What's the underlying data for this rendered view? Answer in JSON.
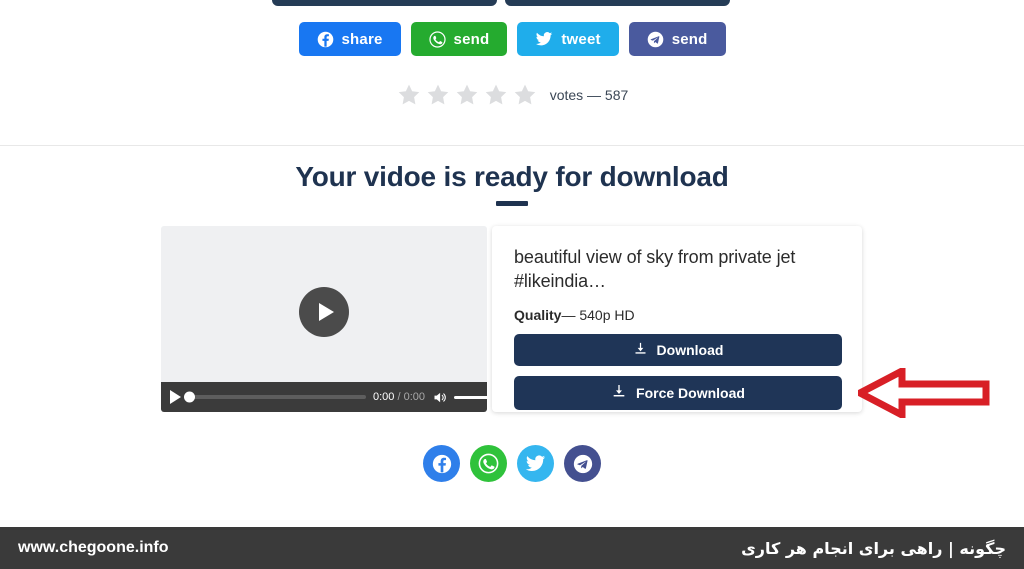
{
  "top_cut_buttons": [
    {
      "name": "cut-button-left"
    },
    {
      "name": "cut-button-right"
    }
  ],
  "share_row": {
    "buttons": [
      {
        "label": "share",
        "network": "facebook",
        "icon": "facebook-icon",
        "color": "#1877f2"
      },
      {
        "label": "send",
        "network": "whatsapp",
        "icon": "whatsapp-icon",
        "color": "#25ab2f"
      },
      {
        "label": "tweet",
        "network": "twitter",
        "icon": "twitter-icon",
        "color": "#1fadeb"
      },
      {
        "label": "send",
        "network": "telegram",
        "icon": "telegram-icon",
        "color": "#4a5a9e"
      }
    ]
  },
  "rating": {
    "stars_total": 5,
    "stars_filled": 0,
    "star_color": "#dcdddf",
    "votes_text": "votes — 587",
    "votes_count": 587
  },
  "heading": {
    "title": "Your vidoe is ready for download",
    "accent_color": "#1f3350"
  },
  "player": {
    "thumbnail_bg": "#eff0f2",
    "big_play_icon": "play-icon",
    "controls": {
      "play_icon": "play-icon",
      "current_time": "0:00",
      "separator": "/",
      "duration": "0:00",
      "volume_icon": "volume-icon",
      "fullscreen_icon": "fullscreen-icon",
      "progress_percent": 0,
      "volume_percent": 100
    }
  },
  "info_card": {
    "video_title": "beautiful view of sky from private jet #likeindia…",
    "quality_label": "Quality",
    "quality_separator": "—",
    "quality_value": "540p HD",
    "buttons": [
      {
        "label": "Download",
        "icon": "download-icon",
        "color": "#1f3557"
      },
      {
        "label": "Force Download",
        "icon": "download-icon",
        "color": "#1f3557"
      }
    ]
  },
  "annotation": {
    "arrow_name": "red-arrow-left",
    "arrow_color": "#d81f26",
    "points_to": "Force Download"
  },
  "social_row": {
    "icons": [
      {
        "network": "facebook",
        "icon": "facebook-icon",
        "color": "#2f7fea"
      },
      {
        "network": "whatsapp",
        "icon": "whatsapp-icon",
        "color": "#2fc23b"
      },
      {
        "network": "twitter",
        "icon": "twitter-icon",
        "color": "#35b6ef"
      },
      {
        "network": "telegram",
        "icon": "telegram-icon",
        "color": "#445090"
      }
    ]
  },
  "footer": {
    "url": "www.chegoone.info",
    "tagline_fa": "چگونه | راهی برای انجام هر کاری",
    "background": "#3a3a3a"
  }
}
